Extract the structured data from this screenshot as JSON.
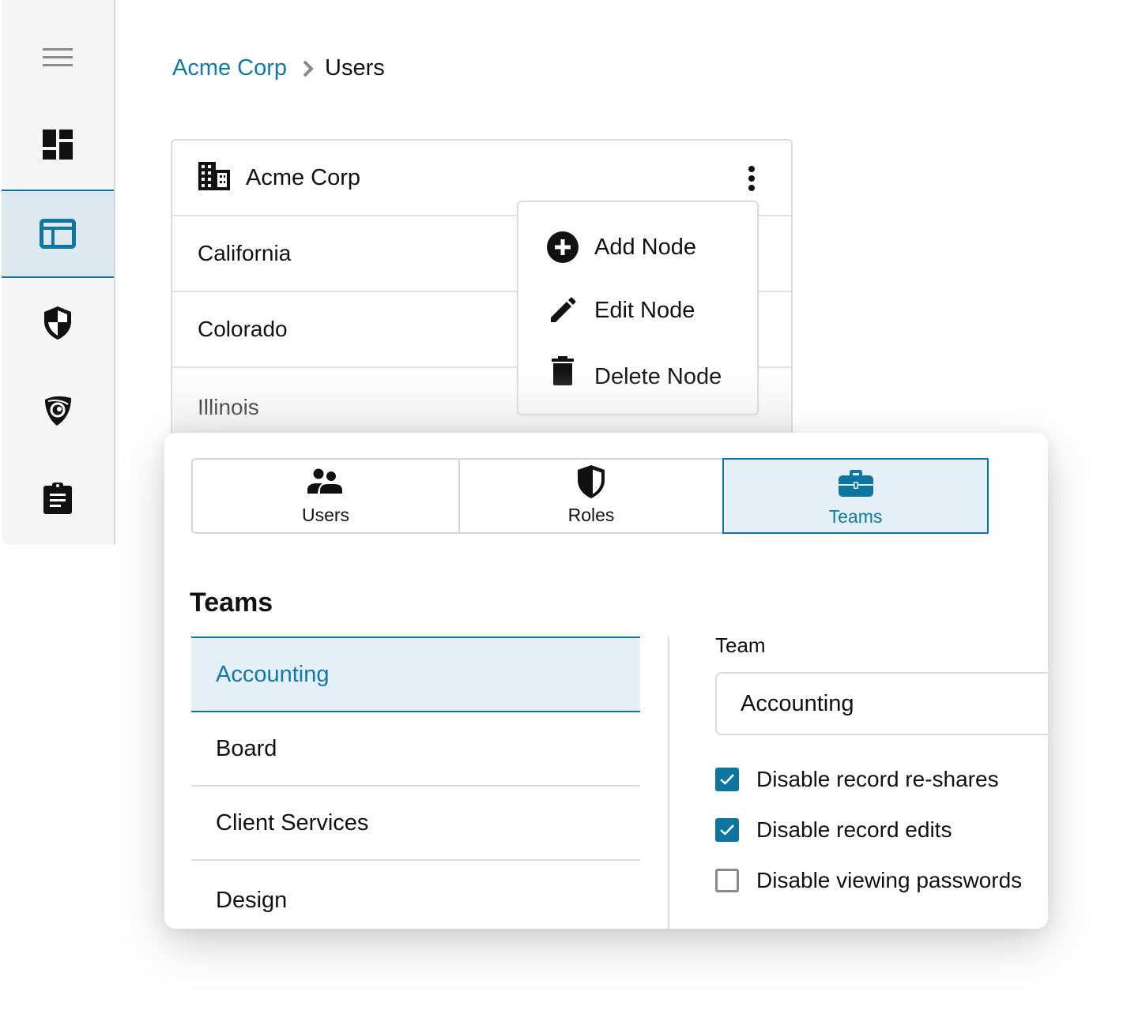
{
  "sidebar": {
    "items": [
      {
        "name": "menu",
        "icon": "hamburger-menu-icon",
        "active": false
      },
      {
        "name": "dashboard",
        "icon": "dashboard-icon",
        "active": false
      },
      {
        "name": "admin-console",
        "icon": "layout-panel-icon",
        "active": true
      },
      {
        "name": "security",
        "icon": "security-shield-icon",
        "active": false
      },
      {
        "name": "breachwatch",
        "icon": "shield-eye-icon",
        "active": false
      },
      {
        "name": "reports",
        "icon": "clipboard-icon",
        "active": false
      }
    ]
  },
  "breadcrumb": {
    "parent": "Acme Corp",
    "separator_icon": "chevron-right-icon",
    "current": "Users"
  },
  "tree": {
    "root": {
      "label": "Acme Corp",
      "icon": "building-icon"
    },
    "nodes": [
      "California",
      "Colorado",
      "Illinois"
    ]
  },
  "context_menu": {
    "items": [
      {
        "label": "Add Node",
        "icon": "add-circle-icon"
      },
      {
        "label": "Edit Node",
        "icon": "pencil-icon"
      },
      {
        "label": "Delete Node",
        "icon": "trash-icon"
      }
    ]
  },
  "tabs": [
    {
      "label": "Users",
      "icon": "users-icon",
      "active": false
    },
    {
      "label": "Roles",
      "icon": "shield-half-icon",
      "active": false
    },
    {
      "label": "Teams",
      "icon": "briefcase-icon",
      "active": true
    }
  ],
  "teams_section": {
    "title": "Teams",
    "teams": [
      "Accounting",
      "Board",
      "Client Services",
      "Design"
    ],
    "selected": "Accounting"
  },
  "team_detail": {
    "field_label": "Team",
    "field_value": "Accounting",
    "options": [
      {
        "label": "Disable record re-shares",
        "checked": true
      },
      {
        "label": "Disable record edits",
        "checked": true
      },
      {
        "label": "Disable viewing passwords",
        "checked": false
      }
    ]
  },
  "colors": {
    "accent": "#0e74a0",
    "accent_text": "#1179a6",
    "selected_bg": "#e4f0f6",
    "sidebar_bg": "#f5f5f5"
  }
}
